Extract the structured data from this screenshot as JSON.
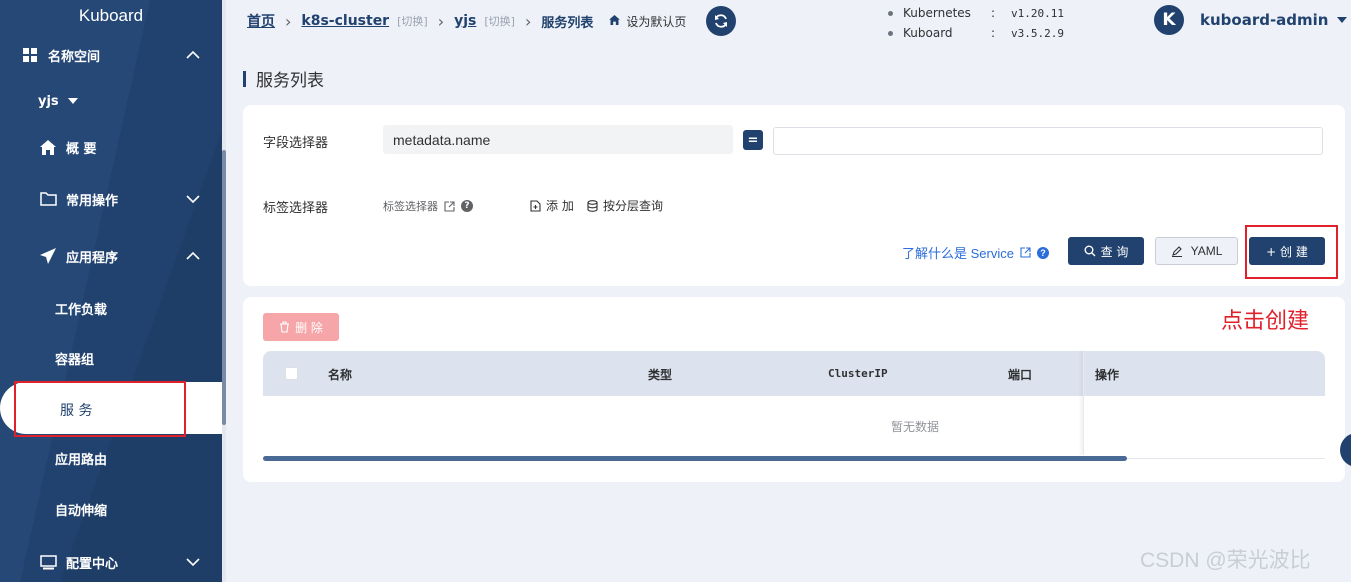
{
  "app": {
    "brand": "Kuboard"
  },
  "colors": {
    "primary": "#21426e",
    "danger": "#e0202b",
    "link": "#2a6ddb",
    "page_bg": "#eef1f7"
  },
  "sidebar": {
    "namespace_section": {
      "label": "名称空间",
      "icon": "grid-icon"
    },
    "namespace_select": "yjs",
    "items": [
      {
        "label": "概 要",
        "icon": "home-icon"
      },
      {
        "label": "常用操作",
        "icon": "folder-icon"
      },
      {
        "label": "应用程序",
        "icon": "send-icon"
      },
      {
        "label": "配置中心",
        "icon": "monitor-icon"
      }
    ],
    "sub_items": [
      {
        "label": "工作负载"
      },
      {
        "label": "容器组"
      },
      {
        "label": "服 务",
        "active": true
      },
      {
        "label": "应用路由"
      },
      {
        "label": "自动伸缩"
      }
    ]
  },
  "header": {
    "breadcrumb": {
      "home": "首页",
      "cluster": "k8s-cluster",
      "switch": "[切换]",
      "namespace": "yjs",
      "current": "服务列表",
      "set_default": "设为默认页"
    },
    "versions": [
      {
        "name": "Kubernetes",
        "colon": ":",
        "value": "v1.20.11"
      },
      {
        "name": "Kuboard",
        "colon": ":",
        "value": "v3.5.2.9"
      }
    ],
    "user": {
      "avatar_letter": "K",
      "name": "kuboard-admin"
    }
  },
  "page": {
    "title": "服务列表"
  },
  "filter": {
    "field_selector_label": "字段选择器",
    "field_key": "metadata.name",
    "operator": "=",
    "field_value": "",
    "label_selector_label": "标签选择器",
    "label_selector_link": "标签选择器",
    "add_label": "添 加",
    "layer_query": "按分层查询",
    "learn_link": "了解什么是 Service",
    "query_button": "查 询",
    "yaml_button": "YAML",
    "create_button": "+ 创 建"
  },
  "table": {
    "delete_button": "删 除",
    "columns": [
      "名称",
      "类型",
      "ClusterIP",
      "端口",
      "操作"
    ],
    "empty_text": "暂无数据"
  },
  "annotation": "点击创建",
  "watermark": "CSDN @荣光波比"
}
